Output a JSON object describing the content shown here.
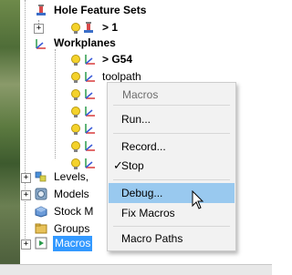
{
  "tree": {
    "hole_feature_sets": "Hole Feature Sets",
    "hfs_child": "> 1",
    "workplanes": "Workplanes",
    "wp_g54": "> G54",
    "wp_toolpath": "toolpath",
    "levels": "Levels,",
    "models": "Models",
    "stock": "Stock M",
    "groups": "Groups",
    "macros": "Macros"
  },
  "context_menu": {
    "title": "Macros",
    "run": "Run...",
    "record": "Record...",
    "stop": "Stop",
    "debug": "Debug...",
    "fix": "Fix Macros",
    "paths": "Macro Paths",
    "check_mark": "✓"
  },
  "icons": [
    "expand-icon",
    "bulb-icon",
    "workplane-icon",
    "hole-feature-icon",
    "levels-icon",
    "models-icon",
    "stock-icon",
    "groups-icon",
    "macros-icon",
    "mouse-cursor-icon"
  ]
}
